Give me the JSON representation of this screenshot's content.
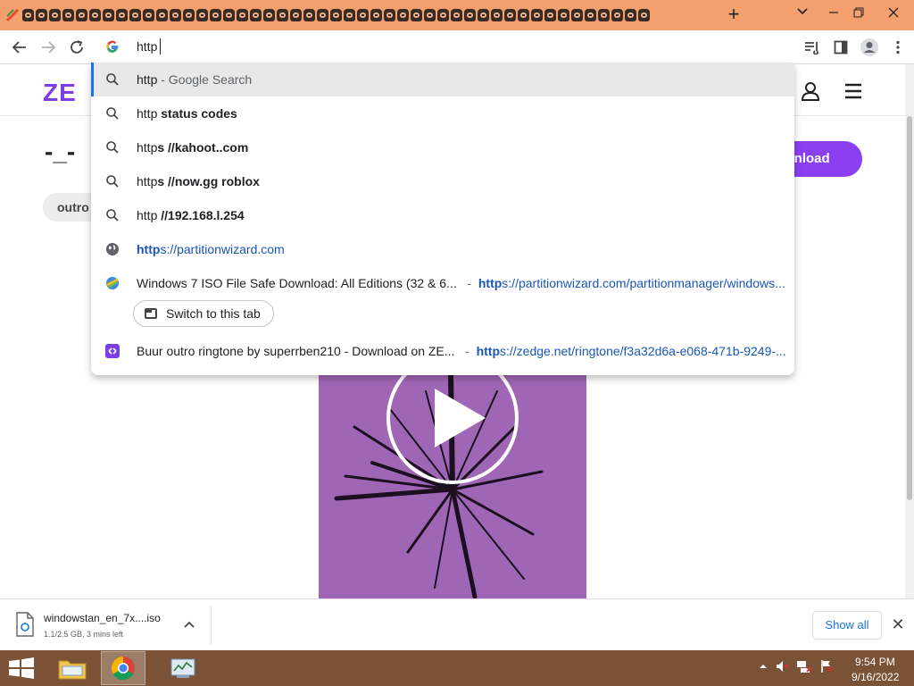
{
  "browser": {
    "tab_count_icons": 48,
    "new_tab_label": "+",
    "window_controls": {
      "tab_search": "⌄",
      "minimize": "—",
      "restore": "❐",
      "close": "✕"
    }
  },
  "omnibox": {
    "typed_text": "http",
    "suggestions": [
      {
        "type": "search",
        "prefix": "http",
        "suffix_dim": " - Google Search",
        "bold": ""
      },
      {
        "type": "search",
        "prefix": "http ",
        "bold": "status codes"
      },
      {
        "type": "search",
        "prefix": "http",
        "bold": "s //kahoot..com"
      },
      {
        "type": "search",
        "prefix": "http",
        "bold": "s //now.gg roblox"
      },
      {
        "type": "search",
        "prefix": "http ",
        "bold": "//192.168.l.254"
      },
      {
        "type": "url",
        "bold": "http",
        "rest": "s://partitionwizard.com"
      },
      {
        "type": "history",
        "title": "Windows 7 ISO File Safe Download: All Editions (32 & 6...",
        "sep": "-",
        "url_bold": "http",
        "url_rest": "s://partitionwizard.com/partitionmanager/windows...",
        "switch_label": "Switch to this tab"
      },
      {
        "type": "history",
        "title": "Buur outro ringtone by superrben210 - Download on ZE...",
        "sep": "-",
        "url_bold": "http",
        "url_rest": "s://zedge.net/ringtone/f3a32d6a-e068-471b-9249-..."
      }
    ]
  },
  "page": {
    "logo": "ZE",
    "title": "-_-",
    "tag": "outro",
    "download_label": "wnload"
  },
  "download_bar": {
    "file_name": "windowstan_en_7x....iso",
    "status": "1.1/2.5 GB, 3 mins left",
    "show_all": "Show all",
    "close": "✕"
  },
  "taskbar": {
    "time": "9:54 PM",
    "date": "9/16/2022"
  }
}
